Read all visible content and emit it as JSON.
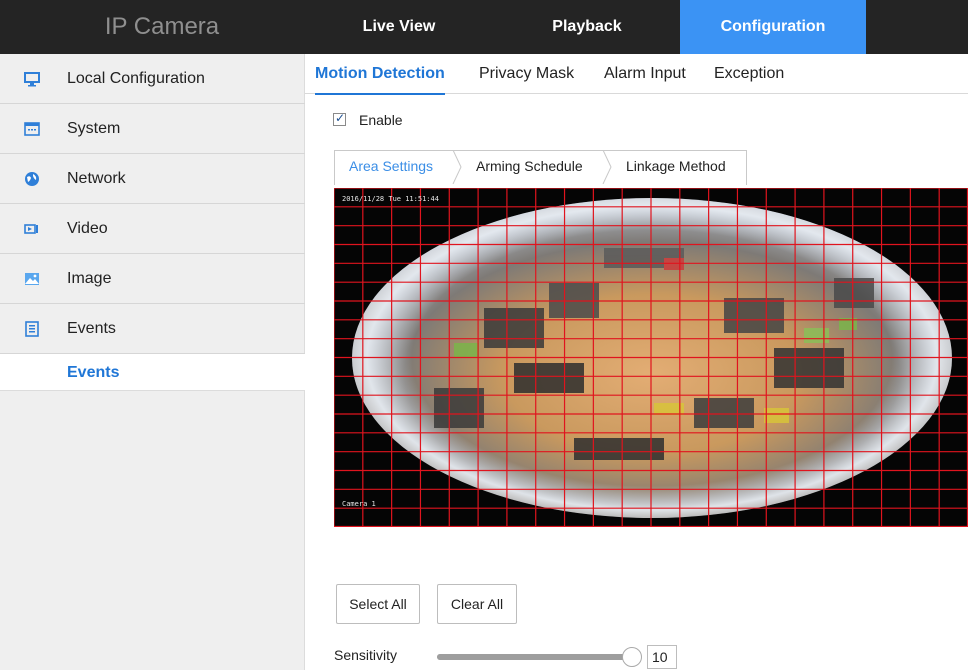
{
  "header": {
    "brand": "IP Camera",
    "nav": [
      {
        "label": "Live View",
        "active": false
      },
      {
        "label": "Playback",
        "active": false
      },
      {
        "label": "Configuration",
        "active": true
      }
    ]
  },
  "sidebar": {
    "items": [
      {
        "label": "Local Configuration",
        "icon": "monitor-icon"
      },
      {
        "label": "System",
        "icon": "system-icon"
      },
      {
        "label": "Network",
        "icon": "globe-icon"
      },
      {
        "label": "Video",
        "icon": "video-camera-icon"
      },
      {
        "label": "Image",
        "icon": "image-icon"
      },
      {
        "label": "Events",
        "icon": "events-icon"
      }
    ],
    "sub_item": {
      "label": "Events",
      "active": true
    }
  },
  "subtabs": [
    {
      "label": "Motion Detection",
      "active": true
    },
    {
      "label": "Privacy Mask",
      "active": false
    },
    {
      "label": "Alarm Input",
      "active": false
    },
    {
      "label": "Exception",
      "active": false
    }
  ],
  "enable": {
    "label": "Enable",
    "checked": true
  },
  "steps": [
    {
      "label": "Area Settings",
      "active": true
    },
    {
      "label": "Arming Schedule",
      "active": false
    },
    {
      "label": "Linkage Method",
      "active": false
    }
  ],
  "video": {
    "grid_columns": 22,
    "grid_rows": 18,
    "grid_color": "#e0141e"
  },
  "buttons": {
    "select_all": "Select All",
    "clear_all": "Clear All"
  },
  "sensitivity": {
    "label": "Sensitivity",
    "value": "10",
    "fraction": 0.95
  },
  "colors": {
    "accent": "#3b93f4",
    "topbar": "#242424",
    "sidebar": "#efefef",
    "link": "#1f76d6"
  }
}
